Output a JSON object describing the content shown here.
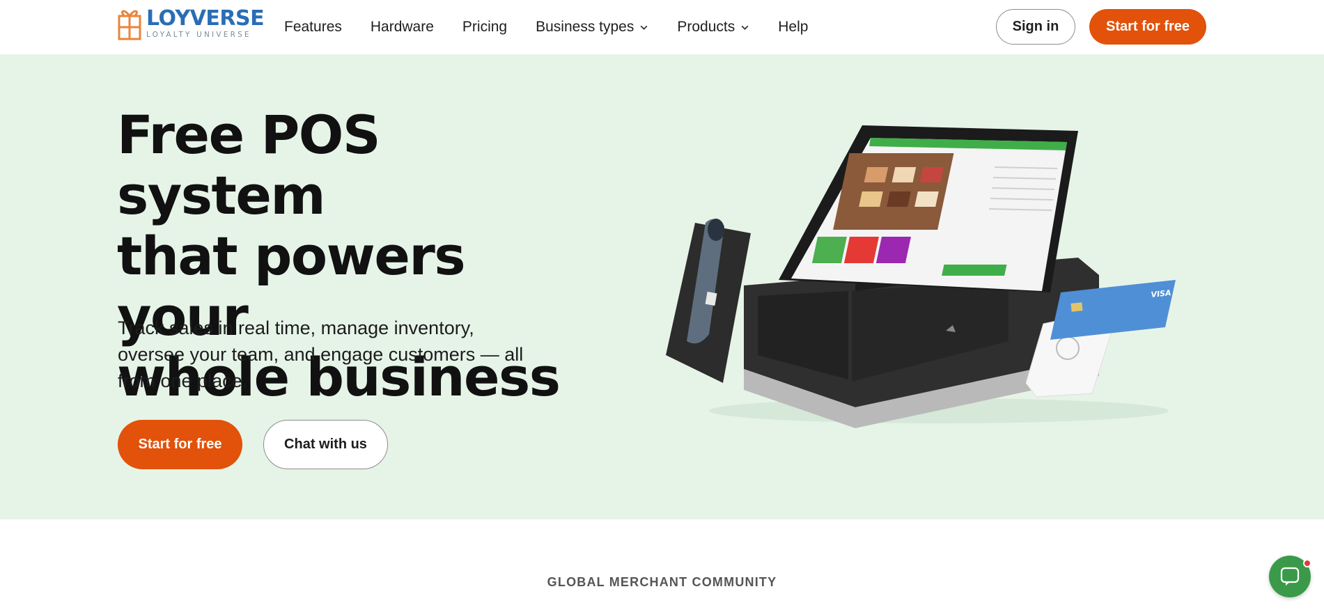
{
  "brand": {
    "name": "LOYVERSE",
    "tagline": "LOYALTY UNIVERSE",
    "logo_color": "#2a6db4",
    "mark_color": "#e9843c"
  },
  "nav": {
    "items": [
      {
        "label": "Features",
        "has_dropdown": false
      },
      {
        "label": "Hardware",
        "has_dropdown": false
      },
      {
        "label": "Pricing",
        "has_dropdown": false
      },
      {
        "label": "Business types",
        "has_dropdown": true
      },
      {
        "label": "Products",
        "has_dropdown": true
      },
      {
        "label": "Help",
        "has_dropdown": false
      }
    ],
    "signin_label": "Sign in",
    "start_label": "Start for free"
  },
  "hero": {
    "title_lines": [
      "Free POS system",
      "that powers your",
      "whole business"
    ],
    "subtitle": "Track sales in real time, manage inventory, oversee your team, and engage customers — all from one place.",
    "primary_cta": "Start for free",
    "secondary_cta": "Chat with us",
    "background": "#e6f4e8"
  },
  "colors": {
    "accent": "#e2520a",
    "chat_widget": "#3a9a4a"
  },
  "community": {
    "heading": "GLOBAL MERCHANT COMMUNITY"
  },
  "icons": {
    "logo": "gift-box-logo-icon",
    "dropdown": "chevron-down-icon",
    "chat": "chat-bubble-icon",
    "hero_image": "pos-hardware-illustration"
  }
}
